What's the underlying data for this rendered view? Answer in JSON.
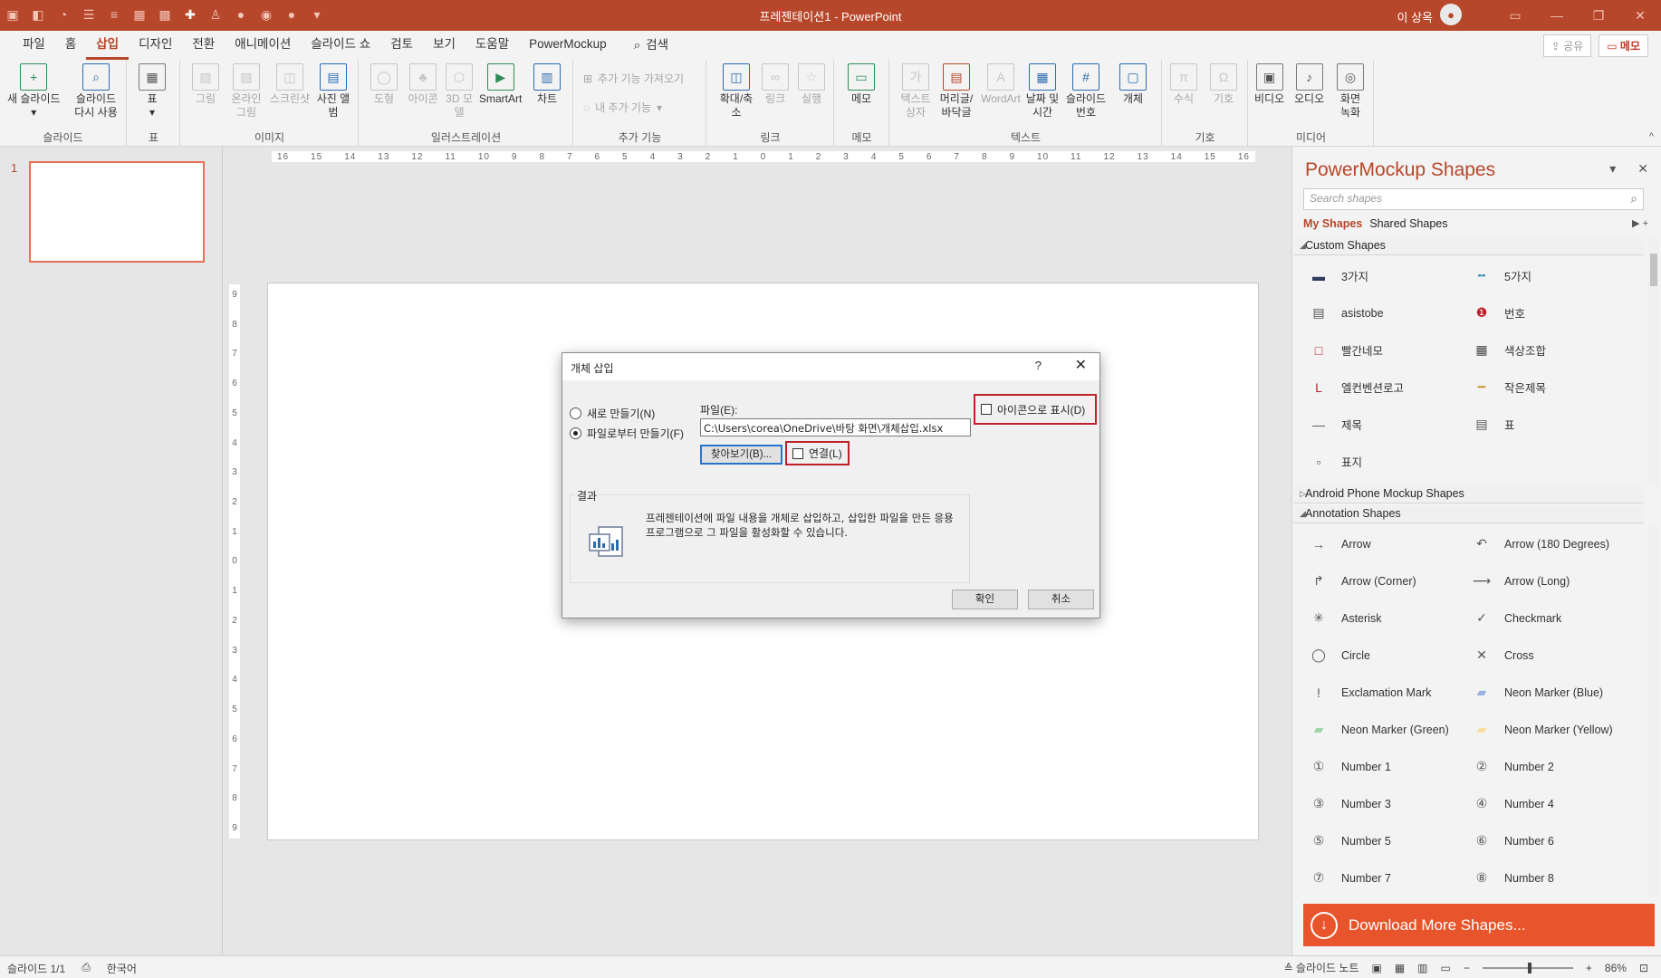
{
  "window": {
    "title": "프레젠테이션1  -  PowerPoint",
    "user_name": "이 상옥",
    "colors": {
      "accent": "#b7472a",
      "download_banner": "#e8542b",
      "highlight_border": "#c0202a"
    }
  },
  "qat_icons": [
    "app-icon",
    "arrange-icon",
    "shape-icon",
    "bullet-icon",
    "list-icon",
    "table-icon",
    "grid-icon",
    "plus-icon",
    "person-icon",
    "circle-icon",
    "circle-icon",
    "circle-icon",
    "customize-icon"
  ],
  "tabs": [
    "파일",
    "홈",
    "삽입",
    "디자인",
    "전환",
    "애니메이션",
    "슬라이드 쇼",
    "검토",
    "보기",
    "도움말",
    "PowerMockup"
  ],
  "active_tab": "삽입",
  "search_tab": "검색",
  "share_label": "공유",
  "memo_label": "메모",
  "ribbon": {
    "groups": [
      {
        "label": "슬라이드",
        "buttons": [
          "새 슬라이드",
          "슬라이드 다시 사용"
        ]
      },
      {
        "label": "표",
        "buttons": [
          "표"
        ]
      },
      {
        "label": "이미지",
        "buttons": [
          "그림",
          "온라인 그림",
          "스크린샷",
          "사진 앨범"
        ]
      },
      {
        "label": "일러스트레이션",
        "buttons": [
          "도형",
          "아이콘",
          "3D 모델",
          "SmartArt",
          "차트"
        ]
      },
      {
        "label": "추가 기능",
        "small": [
          "추가 기능 가져오기",
          "내 추가 기능"
        ]
      },
      {
        "label": "링크",
        "buttons": [
          "확대/축소",
          "링크",
          "실행"
        ]
      },
      {
        "label": "메모",
        "buttons": [
          "메모"
        ]
      },
      {
        "label": "텍스트",
        "buttons": [
          "텍스트 상자",
          "머리글/바닥글",
          "WordArt",
          "날짜 및 시간",
          "슬라이드 번호",
          "개체"
        ]
      },
      {
        "label": "기호",
        "buttons": [
          "수식",
          "기호"
        ]
      },
      {
        "label": "미디어",
        "buttons": [
          "비디오",
          "오디오",
          "화면 녹화"
        ]
      }
    ]
  },
  "thumbnails": {
    "number": "1"
  },
  "ruler": {
    "h_ticks": [
      "16",
      "15",
      "14",
      "13",
      "12",
      "11",
      "10",
      "9",
      "8",
      "7",
      "6",
      "5",
      "4",
      "3",
      "2",
      "1",
      "0",
      "1",
      "2",
      "3",
      "4",
      "5",
      "6",
      "7",
      "8",
      "9",
      "10",
      "11",
      "12",
      "13",
      "14",
      "15",
      "16"
    ],
    "v_ticks": [
      "9",
      "8",
      "7",
      "6",
      "5",
      "4",
      "3",
      "2",
      "1",
      "0",
      "1",
      "2",
      "3",
      "4",
      "5",
      "6",
      "7",
      "8",
      "9"
    ]
  },
  "dialog": {
    "title": "개체 삽입",
    "help": "?",
    "radio_new": "새로 만들기(N)",
    "radio_from_file": "파일로부터 만들기(F)",
    "file_label": "파일(E):",
    "file_path": "C:\\Users\\corea\\OneDrive\\바탕 화면\\개체삽입.xlsx",
    "browse": "찾아보기(B)...",
    "link_label": "연결(L)",
    "display_as_icon": "아이콘으로 표시(D)",
    "result_label": "결과",
    "result_text": "프레젠테이션에 파일 내용을 개체로 삽입하고, 삽입한 파일을 만든 응용 프로그램으로 그 파일을 활성화할 수 있습니다.",
    "ok": "확인",
    "cancel": "취소"
  },
  "panel": {
    "title": "PowerMockup Shapes",
    "search_placeholder": "Search shapes",
    "tab_my": "My Shapes",
    "tab_shared": "Shared Shapes",
    "custom_section": "Custom Shapes",
    "custom_items": [
      {
        "label": "3가지",
        "icon": "device-icon"
      },
      {
        "label": "5가지",
        "icon": "pen-icon"
      },
      {
        "label": "asistobe",
        "icon": "window-icon"
      },
      {
        "label": "번호",
        "icon": "number-badge-icon"
      },
      {
        "label": "빨간네모",
        "icon": "red-square-icon"
      },
      {
        "label": "색상조합",
        "icon": "palette-icon"
      },
      {
        "label": "엘컨벤션로고",
        "icon": "logo-icon"
      },
      {
        "label": "작은제목",
        "icon": "bar-icon"
      },
      {
        "label": "제목",
        "icon": "line-icon"
      },
      {
        "label": "표",
        "icon": "table-icon"
      },
      {
        "label": "표지",
        "icon": "cover-icon"
      }
    ],
    "android_section": "Android Phone Mockup Shapes",
    "annotation_section": "Annotation Shapes",
    "annotation_items": [
      {
        "label": "Arrow",
        "icon": "arrow-icon"
      },
      {
        "label": "Arrow (180 Degrees)",
        "icon": "arrow-180-icon"
      },
      {
        "label": "Arrow (Corner)",
        "icon": "arrow-corner-icon"
      },
      {
        "label": "Arrow (Long)",
        "icon": "arrow-long-icon"
      },
      {
        "label": "Asterisk",
        "icon": "asterisk-icon"
      },
      {
        "label": "Checkmark",
        "icon": "checkmark-icon"
      },
      {
        "label": "Circle",
        "icon": "circle-icon"
      },
      {
        "label": "Cross",
        "icon": "cross-icon"
      },
      {
        "label": "Exclamation Mark",
        "icon": "exclamation-icon"
      },
      {
        "label": "Neon Marker (Blue)",
        "icon": "marker-blue-icon"
      },
      {
        "label": "Neon Marker (Green)",
        "icon": "marker-green-icon"
      },
      {
        "label": "Neon Marker (Yellow)",
        "icon": "marker-yellow-icon"
      },
      {
        "label": "Number 1",
        "icon": "number-1-icon"
      },
      {
        "label": "Number 2",
        "icon": "number-2-icon"
      },
      {
        "label": "Number 3",
        "icon": "number-3-icon"
      },
      {
        "label": "Number 4",
        "icon": "number-4-icon"
      },
      {
        "label": "Number 5",
        "icon": "number-5-icon"
      },
      {
        "label": "Number 6",
        "icon": "number-6-icon"
      },
      {
        "label": "Number 7",
        "icon": "number-7-icon"
      },
      {
        "label": "Number 8",
        "icon": "number-8-icon"
      }
    ],
    "download": "Download More Shapes..."
  },
  "status": {
    "slide": "슬라이드 1/1",
    "language": "한국어",
    "notes": "슬라이드 노트",
    "zoom": "86%"
  }
}
